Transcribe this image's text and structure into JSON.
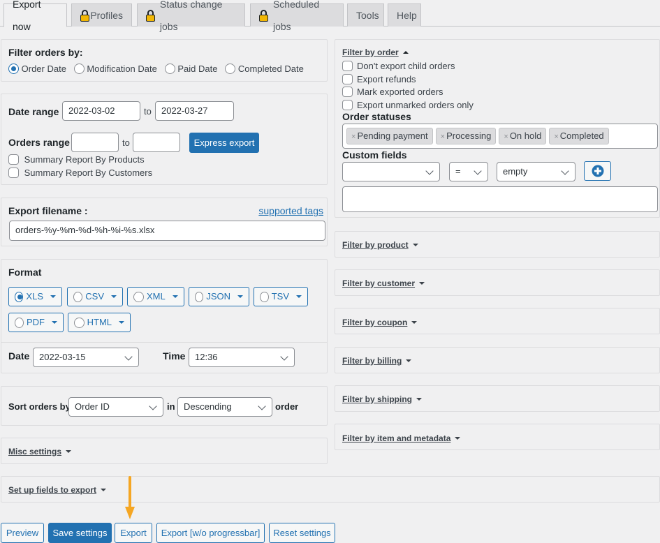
{
  "tabs": [
    {
      "label": "Export now",
      "active": true,
      "locked": false
    },
    {
      "label": "Profiles",
      "active": false,
      "locked": true
    },
    {
      "label": "Status change jobs",
      "active": false,
      "locked": true
    },
    {
      "label": "Scheduled jobs",
      "active": false,
      "locked": true
    },
    {
      "label": "Tools",
      "active": false,
      "locked": false
    },
    {
      "label": "Help",
      "active": false,
      "locked": false
    }
  ],
  "filter_orders_by": {
    "title": "Filter orders by:",
    "options": [
      {
        "label": "Order Date",
        "checked": true
      },
      {
        "label": "Modification Date",
        "checked": false
      },
      {
        "label": "Paid Date",
        "checked": false
      },
      {
        "label": "Completed Date",
        "checked": false
      }
    ]
  },
  "date_range": {
    "label": "Date range",
    "from": "2022-03-02",
    "to_label": "to",
    "to": "2022-03-27"
  },
  "orders_range": {
    "label": "Orders range",
    "from": "",
    "to_label": "to",
    "to": "",
    "express_export_label": "Express export"
  },
  "summary": {
    "by_products": {
      "label": "Summary Report By Products",
      "checked": false
    },
    "by_customers": {
      "label": "Summary Report By Customers",
      "checked": false
    }
  },
  "export_filename": {
    "label": "Export filename :",
    "supported_tags_link": "supported tags",
    "value": "orders-%y-%m-%d-%h-%i-%s.xlsx"
  },
  "format": {
    "title": "Format",
    "options": [
      {
        "label": "XLS",
        "checked": true
      },
      {
        "label": "CSV",
        "checked": false
      },
      {
        "label": "XML",
        "checked": false
      },
      {
        "label": "JSON",
        "checked": false
      },
      {
        "label": "TSV",
        "checked": false
      },
      {
        "label": "PDF",
        "checked": false
      },
      {
        "label": "HTML",
        "checked": false
      }
    ],
    "date_label": "Date",
    "date_value": "2022-03-15",
    "time_label": "Time",
    "time_value": "12:36"
  },
  "sort": {
    "label": "Sort orders by",
    "field": "Order ID",
    "in_label": "in",
    "direction": "Descending",
    "order_label": "order"
  },
  "misc_settings": {
    "label": "Misc settings"
  },
  "setup_fields": {
    "label": "Set up fields to export"
  },
  "filter_by_order": {
    "title": "Filter by order",
    "checkboxes": [
      {
        "label": "Don't export child orders",
        "checked": false
      },
      {
        "label": "Export refunds",
        "checked": false
      },
      {
        "label": "Mark exported orders",
        "checked": false
      },
      {
        "label": "Export unmarked orders only",
        "checked": false
      }
    ],
    "order_statuses_label": "Order statuses",
    "order_statuses": [
      "Pending payment",
      "Processing",
      "On hold",
      "Completed"
    ],
    "custom_fields_label": "Custom fields",
    "custom_field_key": "",
    "custom_field_operator": "=",
    "custom_field_value": "empty",
    "custom_fields_text": ""
  },
  "filter_sections": [
    {
      "label": "Filter by product"
    },
    {
      "label": "Filter by customer"
    },
    {
      "label": "Filter by coupon"
    },
    {
      "label": "Filter by billing"
    },
    {
      "label": "Filter by shipping"
    },
    {
      "label": "Filter by item and metadata"
    }
  ],
  "actions": {
    "preview": "Preview",
    "save_settings": "Save settings",
    "export": "Export",
    "export_no_progress": "Export [w/o progressbar]",
    "reset_settings": "Reset settings"
  },
  "colors": {
    "accent": "#2271b1",
    "background": "#f0f0f1",
    "annotation_arrow": "#f5a623",
    "lock": "#f2b705"
  }
}
